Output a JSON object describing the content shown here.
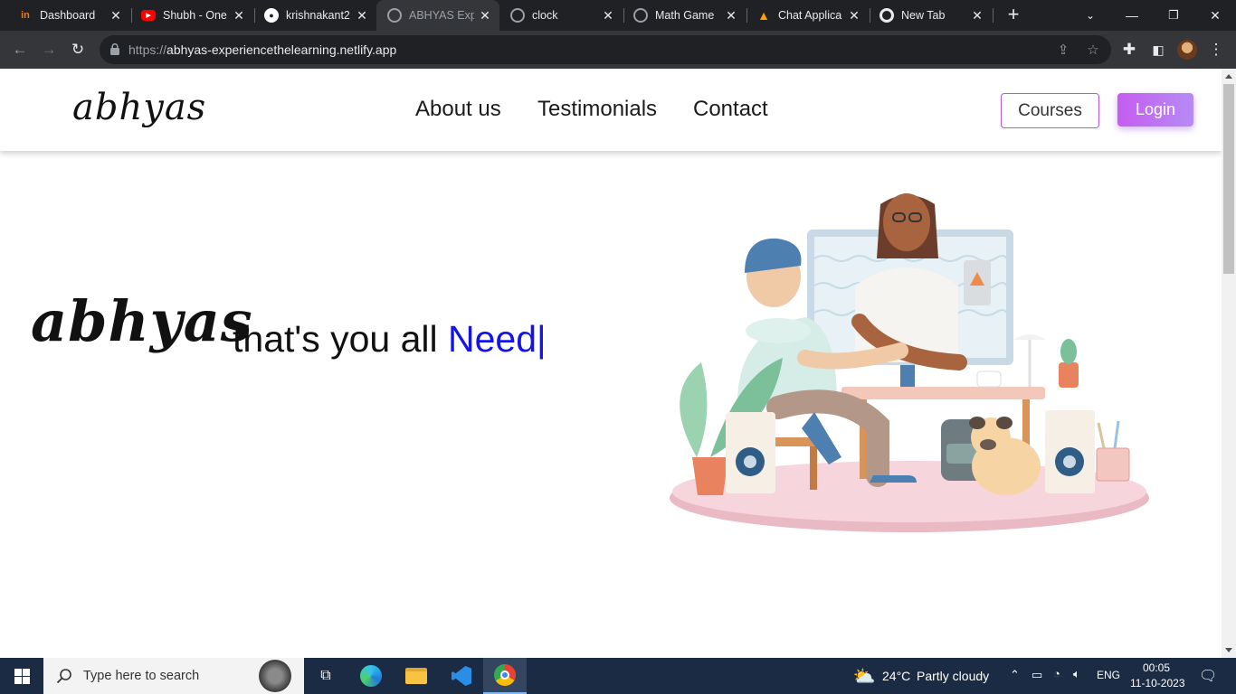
{
  "browser": {
    "tabs": [
      {
        "title": "Dashboard",
        "favicon": "dashboard-favicon",
        "favicon_color": "#f07a1a"
      },
      {
        "title": "Shubh - One",
        "favicon": "youtube-favicon",
        "favicon_color": "#ff0000"
      },
      {
        "title": "krishnakant2",
        "favicon": "github-favicon",
        "favicon_color": "#ffffff"
      },
      {
        "title": "ABHYAS Expe",
        "favicon": "globe-favicon",
        "favicon_color": "#9aa0a6",
        "active": true
      },
      {
        "title": "clock",
        "favicon": "globe-favicon",
        "favicon_color": "#9aa0a6"
      },
      {
        "title": "Math Game",
        "favicon": "globe-favicon",
        "favicon_color": "#9aa0a6"
      },
      {
        "title": "Chat Applica",
        "favicon": "firebase-favicon",
        "favicon_color": "#ffa000"
      },
      {
        "title": "New Tab",
        "favicon": "chrome-favicon",
        "favicon_color": "#e8eaed"
      }
    ],
    "url_scheme": "https://",
    "url_host": "abhyas-experiencethelearning.netlify.app"
  },
  "page": {
    "nav": {
      "logo": "abhyas",
      "links": [
        "About us",
        "Testimonials",
        "Contact"
      ],
      "courses_label": "Courses",
      "login_label": "Login",
      "accent": "#b158e8"
    },
    "hero": {
      "logo": "abhyas",
      "tagline": "that's you all ",
      "typed_word": "Need",
      "cursor": "|",
      "typed_color": "#1414e8"
    }
  },
  "taskbar": {
    "search_placeholder": "Type here to search",
    "weather_temp": "24°C",
    "weather_desc": "Partly cloudy",
    "language": "ENG",
    "time": "00:05",
    "date": "11-10-2023"
  }
}
